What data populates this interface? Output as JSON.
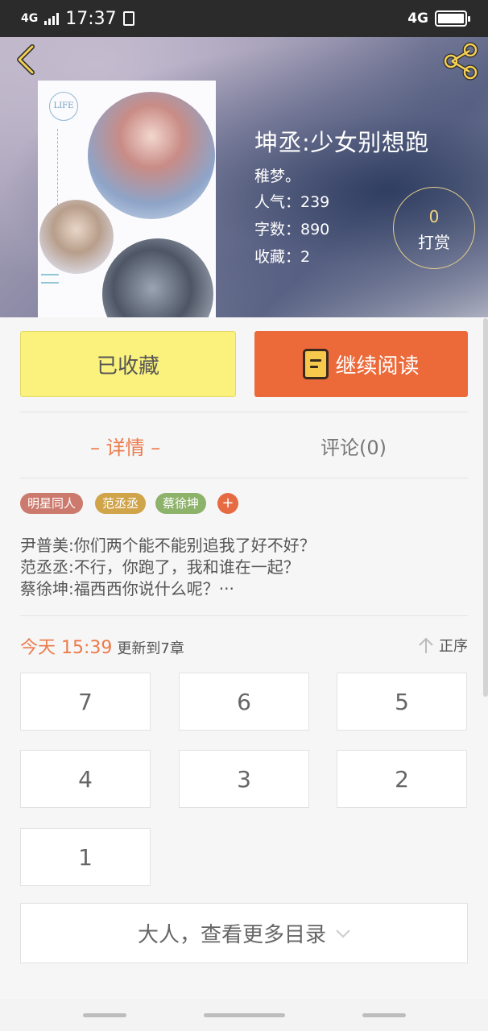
{
  "status_bar": {
    "network_left": "4G",
    "time": "17:37",
    "network_right": "4G"
  },
  "book": {
    "title": "坤丞:少女别想跑",
    "author": "稚梦。",
    "popularity": "人气：239",
    "word_count": "字数：890",
    "favorites": "收藏：2",
    "cover_badge": "LIFE"
  },
  "reward": {
    "count": "0",
    "label": "打赏"
  },
  "actions": {
    "favorite_label": "已收藏",
    "continue_label": "继续阅读"
  },
  "tabs": {
    "detail": "– 详情 –",
    "comments": "评论(0)"
  },
  "tags": [
    "明星同人",
    "范丞丞",
    "蔡徐坤"
  ],
  "tag_add": "+",
  "description": [
    "尹普美:你们两个能不能别追我了好不好？",
    "范丞丞:不行，你跑了，我和谁在一起？",
    "蔡徐坤:福西西你说什么呢？···"
  ],
  "update": {
    "when": "今天 15:39",
    "chapter_text": "更新到7章"
  },
  "sort_label": "正序",
  "chapters": [
    "7",
    "6",
    "5",
    "4",
    "3",
    "2",
    "1"
  ],
  "more_catalog": "大人，查看更多目录",
  "colors": {
    "accent": "#ec6a3a",
    "favorite_bg": "#fbf27e",
    "tab_active": "#ec7b4b"
  },
  "icons": {
    "back": "back-arrow-icon",
    "share": "share-icon",
    "book": "book-icon",
    "sort": "arrow-up-icon",
    "expand": "chevron-down-icon"
  }
}
